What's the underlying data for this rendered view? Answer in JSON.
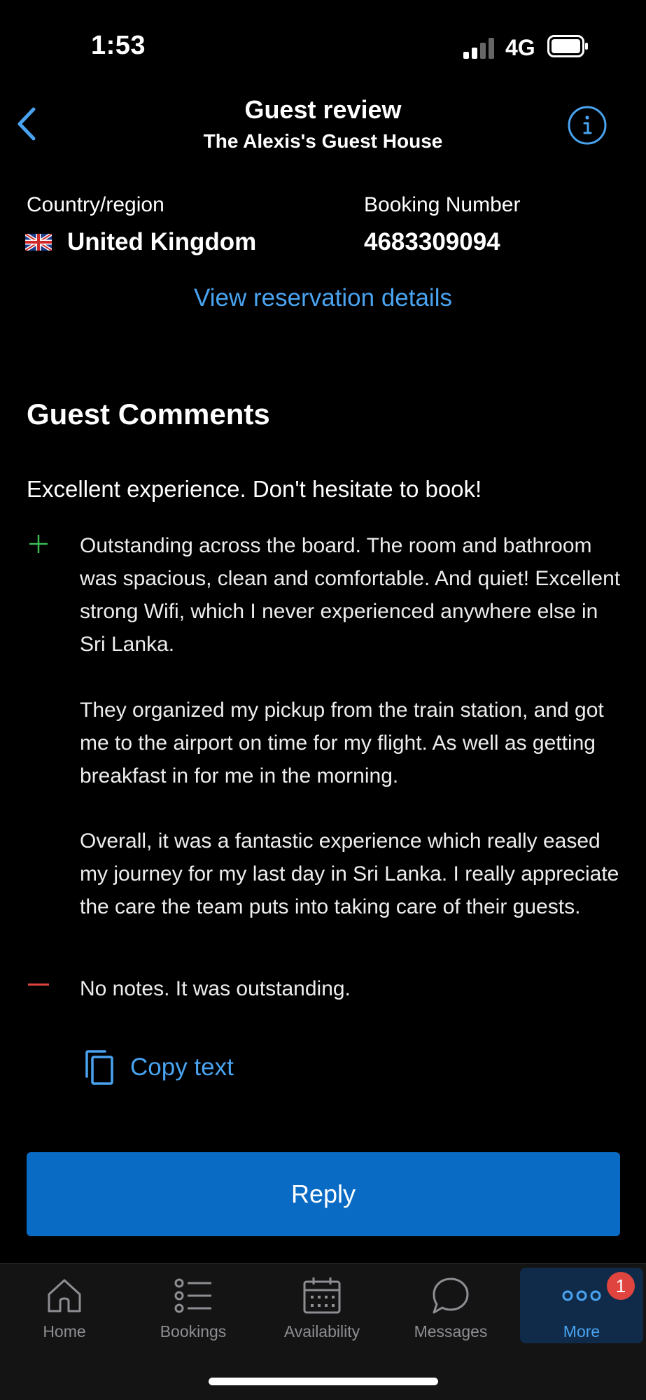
{
  "status_bar": {
    "time": "1:53",
    "network": "4G"
  },
  "header": {
    "title": "Guest review",
    "subtitle": "The Alexis's Guest House"
  },
  "guest_info": {
    "country_label": "Country/region",
    "country_value": "United Kingdom",
    "booking_label": "Booking Number",
    "booking_value": "4683309094"
  },
  "view_reservation_link": "View reservation details",
  "comments": {
    "section_title": "Guest Comments",
    "review_title": "Excellent experience. Don't hesitate to book!",
    "positive_paragraphs": [
      "Outstanding across the board. The room and bathroom was spacious, clean and comfortable. And quiet! Excellent strong Wifi, which I never experienced anywhere else in Sri Lanka.",
      "They organized my pickup from the train station, and got me to the airport on time for my flight. As well as getting breakfast in for me in the morning.",
      "Overall, it was a fantastic experience which really eased my journey for my last day in Sri Lanka. I really appreciate the care the team puts into taking care of their guests."
    ],
    "negative": "No notes. It was outstanding."
  },
  "copy_text_label": "Copy text",
  "reply_label": "Reply",
  "tabs": [
    {
      "label": "Home",
      "icon": "home-icon"
    },
    {
      "label": "Bookings",
      "icon": "list-icon"
    },
    {
      "label": "Availability",
      "icon": "calendar-icon"
    },
    {
      "label": "Messages",
      "icon": "chat-bubble-icon"
    },
    {
      "label": "More",
      "icon": "more-dots-icon",
      "badge": "1",
      "active": true
    }
  ],
  "colors": {
    "accent": "#4aa3f0",
    "reply_button": "#0a6bc5",
    "positive": "#3cba54",
    "negative": "#e0443e"
  }
}
